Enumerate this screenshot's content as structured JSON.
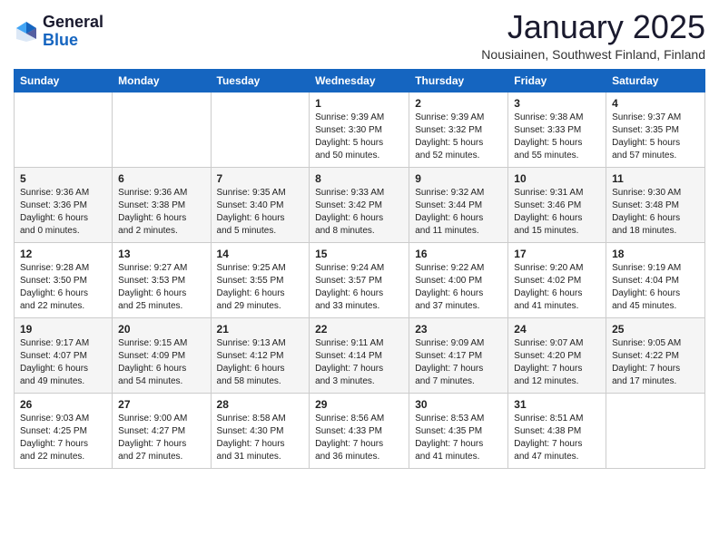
{
  "header": {
    "logo_general": "General",
    "logo_blue": "Blue",
    "month": "January 2025",
    "location": "Nousiainen, Southwest Finland, Finland"
  },
  "weekdays": [
    "Sunday",
    "Monday",
    "Tuesday",
    "Wednesday",
    "Thursday",
    "Friday",
    "Saturday"
  ],
  "weeks": [
    [
      {
        "day": "",
        "info": ""
      },
      {
        "day": "",
        "info": ""
      },
      {
        "day": "",
        "info": ""
      },
      {
        "day": "1",
        "info": "Sunrise: 9:39 AM\nSunset: 3:30 PM\nDaylight: 5 hours\nand 50 minutes."
      },
      {
        "day": "2",
        "info": "Sunrise: 9:39 AM\nSunset: 3:32 PM\nDaylight: 5 hours\nand 52 minutes."
      },
      {
        "day": "3",
        "info": "Sunrise: 9:38 AM\nSunset: 3:33 PM\nDaylight: 5 hours\nand 55 minutes."
      },
      {
        "day": "4",
        "info": "Sunrise: 9:37 AM\nSunset: 3:35 PM\nDaylight: 5 hours\nand 57 minutes."
      }
    ],
    [
      {
        "day": "5",
        "info": "Sunrise: 9:36 AM\nSunset: 3:36 PM\nDaylight: 6 hours\nand 0 minutes."
      },
      {
        "day": "6",
        "info": "Sunrise: 9:36 AM\nSunset: 3:38 PM\nDaylight: 6 hours\nand 2 minutes."
      },
      {
        "day": "7",
        "info": "Sunrise: 9:35 AM\nSunset: 3:40 PM\nDaylight: 6 hours\nand 5 minutes."
      },
      {
        "day": "8",
        "info": "Sunrise: 9:33 AM\nSunset: 3:42 PM\nDaylight: 6 hours\nand 8 minutes."
      },
      {
        "day": "9",
        "info": "Sunrise: 9:32 AM\nSunset: 3:44 PM\nDaylight: 6 hours\nand 11 minutes."
      },
      {
        "day": "10",
        "info": "Sunrise: 9:31 AM\nSunset: 3:46 PM\nDaylight: 6 hours\nand 15 minutes."
      },
      {
        "day": "11",
        "info": "Sunrise: 9:30 AM\nSunset: 3:48 PM\nDaylight: 6 hours\nand 18 minutes."
      }
    ],
    [
      {
        "day": "12",
        "info": "Sunrise: 9:28 AM\nSunset: 3:50 PM\nDaylight: 6 hours\nand 22 minutes."
      },
      {
        "day": "13",
        "info": "Sunrise: 9:27 AM\nSunset: 3:53 PM\nDaylight: 6 hours\nand 25 minutes."
      },
      {
        "day": "14",
        "info": "Sunrise: 9:25 AM\nSunset: 3:55 PM\nDaylight: 6 hours\nand 29 minutes."
      },
      {
        "day": "15",
        "info": "Sunrise: 9:24 AM\nSunset: 3:57 PM\nDaylight: 6 hours\nand 33 minutes."
      },
      {
        "day": "16",
        "info": "Sunrise: 9:22 AM\nSunset: 4:00 PM\nDaylight: 6 hours\nand 37 minutes."
      },
      {
        "day": "17",
        "info": "Sunrise: 9:20 AM\nSunset: 4:02 PM\nDaylight: 6 hours\nand 41 minutes."
      },
      {
        "day": "18",
        "info": "Sunrise: 9:19 AM\nSunset: 4:04 PM\nDaylight: 6 hours\nand 45 minutes."
      }
    ],
    [
      {
        "day": "19",
        "info": "Sunrise: 9:17 AM\nSunset: 4:07 PM\nDaylight: 6 hours\nand 49 minutes."
      },
      {
        "day": "20",
        "info": "Sunrise: 9:15 AM\nSunset: 4:09 PM\nDaylight: 6 hours\nand 54 minutes."
      },
      {
        "day": "21",
        "info": "Sunrise: 9:13 AM\nSunset: 4:12 PM\nDaylight: 6 hours\nand 58 minutes."
      },
      {
        "day": "22",
        "info": "Sunrise: 9:11 AM\nSunset: 4:14 PM\nDaylight: 7 hours\nand 3 minutes."
      },
      {
        "day": "23",
        "info": "Sunrise: 9:09 AM\nSunset: 4:17 PM\nDaylight: 7 hours\nand 7 minutes."
      },
      {
        "day": "24",
        "info": "Sunrise: 9:07 AM\nSunset: 4:20 PM\nDaylight: 7 hours\nand 12 minutes."
      },
      {
        "day": "25",
        "info": "Sunrise: 9:05 AM\nSunset: 4:22 PM\nDaylight: 7 hours\nand 17 minutes."
      }
    ],
    [
      {
        "day": "26",
        "info": "Sunrise: 9:03 AM\nSunset: 4:25 PM\nDaylight: 7 hours\nand 22 minutes."
      },
      {
        "day": "27",
        "info": "Sunrise: 9:00 AM\nSunset: 4:27 PM\nDaylight: 7 hours\nand 27 minutes."
      },
      {
        "day": "28",
        "info": "Sunrise: 8:58 AM\nSunset: 4:30 PM\nDaylight: 7 hours\nand 31 minutes."
      },
      {
        "day": "29",
        "info": "Sunrise: 8:56 AM\nSunset: 4:33 PM\nDaylight: 7 hours\nand 36 minutes."
      },
      {
        "day": "30",
        "info": "Sunrise: 8:53 AM\nSunset: 4:35 PM\nDaylight: 7 hours\nand 41 minutes."
      },
      {
        "day": "31",
        "info": "Sunrise: 8:51 AM\nSunset: 4:38 PM\nDaylight: 7 hours\nand 47 minutes."
      },
      {
        "day": "",
        "info": ""
      }
    ]
  ]
}
